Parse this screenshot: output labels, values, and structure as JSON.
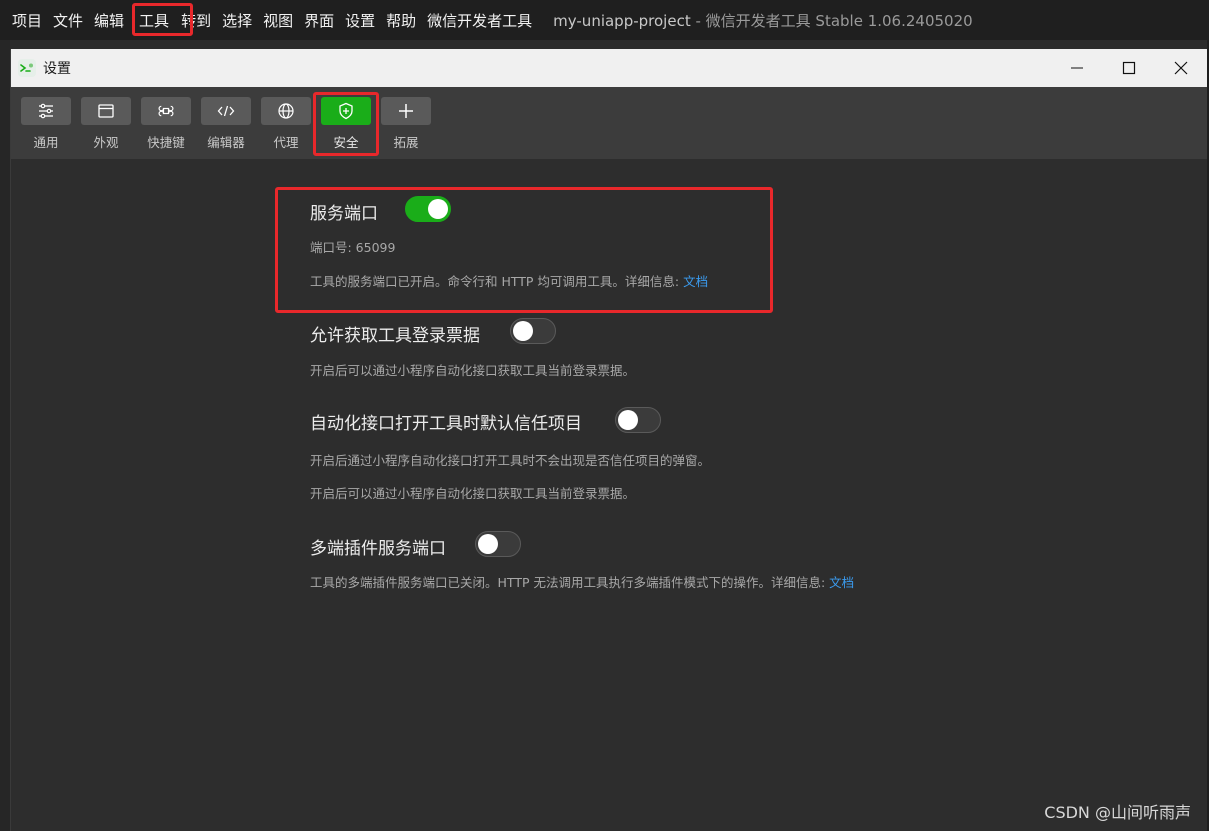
{
  "menubar": {
    "items": [
      "项目",
      "文件",
      "编辑",
      "工具",
      "转到",
      "选择",
      "视图",
      "界面",
      "设置",
      "帮助",
      "微信开发者工具"
    ],
    "project": "my-uniapp-project",
    "app_title": " - 微信开发者工具 Stable 1.06.2405020"
  },
  "dialog": {
    "title": "设置"
  },
  "toolbar": {
    "items": [
      {
        "label": "通用",
        "icon": "sliders-icon"
      },
      {
        "label": "外观",
        "icon": "window-icon"
      },
      {
        "label": "快捷键",
        "icon": "command-icon"
      },
      {
        "label": "编辑器",
        "icon": "code-icon"
      },
      {
        "label": "代理",
        "icon": "globe-icon"
      },
      {
        "label": "安全",
        "icon": "shield-icon",
        "active": true
      },
      {
        "label": "拓展",
        "icon": "plus-icon"
      }
    ]
  },
  "settings": {
    "service_port": {
      "title": "服务端口",
      "enabled": true,
      "port_label": "端口号: 65099",
      "desc": "工具的服务端口已开启。命令行和 HTTP 均可调用工具。详细信息: ",
      "link": "文档"
    },
    "login_ticket": {
      "title": "允许获取工具登录票据",
      "enabled": false,
      "desc": "开启后可以通过小程序自动化接口获取工具当前登录票据。"
    },
    "trust_project": {
      "title": "自动化接口打开工具时默认信任项目",
      "enabled": false,
      "desc1": "开启后通过小程序自动化接口打开工具时不会出现是否信任项目的弹窗。",
      "desc2": "开启后可以通过小程序自动化接口获取工具当前登录票据。"
    },
    "multi_port": {
      "title": "多端插件服务端口",
      "enabled": false,
      "desc": "工具的多端插件服务端口已关闭。HTTP 无法调用工具执行多端插件模式下的操作。详细信息: ",
      "link": "文档"
    }
  },
  "watermark": "CSDN @山间听雨声"
}
